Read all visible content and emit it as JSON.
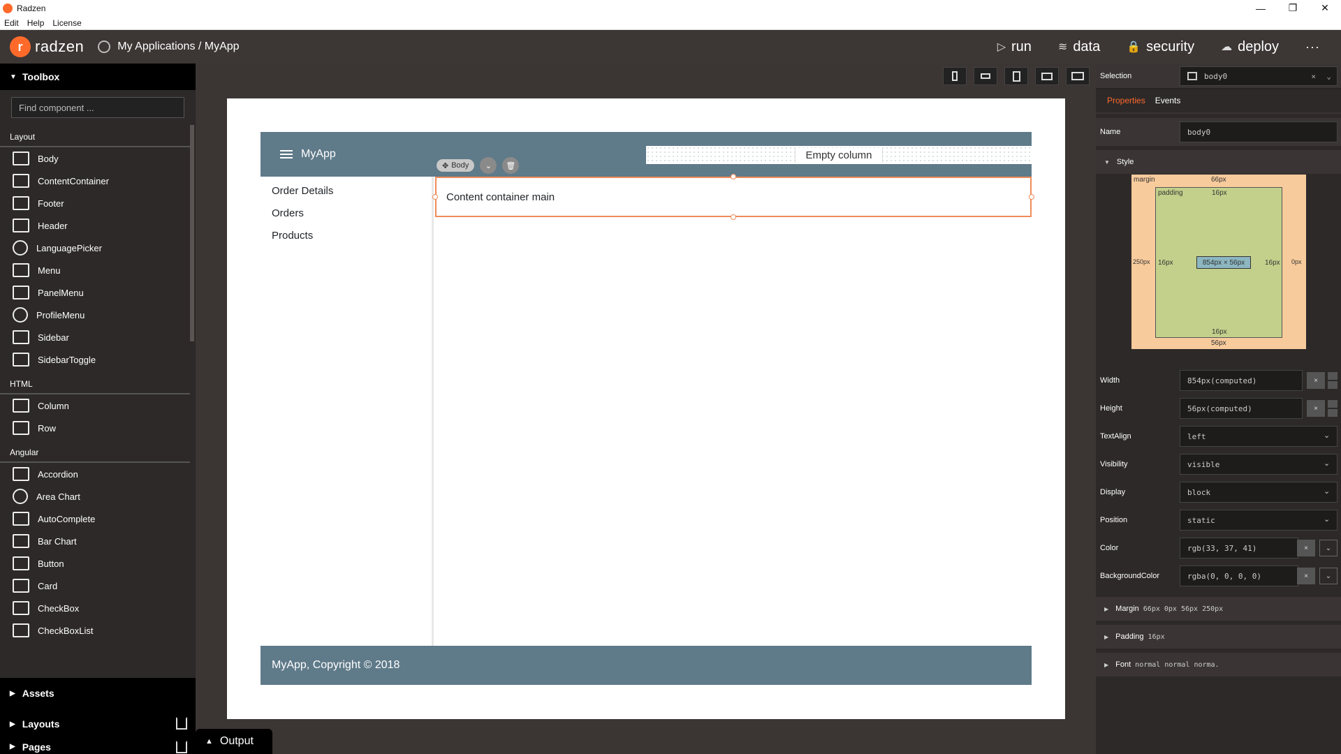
{
  "window": {
    "title": "Radzen",
    "menu": [
      "Edit",
      "Help",
      "License"
    ],
    "controls": [
      "—",
      "❐",
      "✕"
    ]
  },
  "header": {
    "logo_text": "radzen",
    "breadcrumb": "My Applications / MyApp",
    "nav": [
      {
        "label": "run",
        "icon": "play-icon",
        "glyph": "▷"
      },
      {
        "label": "data",
        "icon": "database-icon",
        "glyph": "≋"
      },
      {
        "label": "security",
        "icon": "lock-icon",
        "glyph": "🔒"
      },
      {
        "label": "deploy",
        "icon": "cloud-upload-icon",
        "glyph": "☁"
      }
    ],
    "more": "···"
  },
  "toolbox": {
    "title": "Toolbox",
    "search_placeholder": "Find component ...",
    "categories": [
      {
        "label": "Layout",
        "items": [
          "Body",
          "ContentContainer",
          "Footer",
          "Header",
          "LanguagePicker",
          "Menu",
          "PanelMenu",
          "ProfileMenu",
          "Sidebar",
          "SidebarToggle"
        ]
      },
      {
        "label": "HTML",
        "items": [
          "Column",
          "Row"
        ]
      },
      {
        "label": "Angular",
        "items": [
          "Accordion",
          "Area Chart",
          "AutoComplete",
          "Bar Chart",
          "Button",
          "Card",
          "CheckBox",
          "CheckBoxList"
        ]
      }
    ],
    "bottom": [
      "Assets",
      "Layouts",
      "Pages"
    ]
  },
  "canvas": {
    "app_title": "MyApp",
    "empty_column": "Empty column",
    "body_label": "Body",
    "sidebar_links": [
      "Order Details",
      "Orders",
      "Products"
    ],
    "content_text": "Content container main",
    "footer_text": "MyApp, Copyright © 2018"
  },
  "output_tab": "Output",
  "properties": {
    "selection_label": "Selection",
    "selection_value": "body0",
    "tabs": [
      "Properties",
      "Events"
    ],
    "name_label": "Name",
    "name_value": "body0",
    "style_label": "Style",
    "box": {
      "margin": "margin",
      "padding": "padding",
      "margin_top": "66px",
      "margin_bottom": "56px",
      "margin_left": "250px",
      "margin_right": "0px",
      "padding_top": "16px",
      "padding_bottom": "16px",
      "padding_left": "16px",
      "padding_right": "16px",
      "size": "854px × 56px"
    },
    "fields": [
      {
        "label": "Width",
        "value": "854px(computed)"
      },
      {
        "label": "Height",
        "value": "56px(computed)"
      },
      {
        "label": "TextAlign",
        "value": "left"
      },
      {
        "label": "Visibility",
        "value": "visible"
      },
      {
        "label": "Display",
        "value": "block"
      },
      {
        "label": "Position",
        "value": "static"
      },
      {
        "label": "Color",
        "value": "rgb(33, 37, 41)"
      },
      {
        "label": "BackgroundColor",
        "value": "rgba(0, 0, 0, 0)"
      }
    ],
    "sections": [
      {
        "label": "Margin",
        "value": "66px 0px 56px 250px"
      },
      {
        "label": "Padding",
        "value": "16px"
      },
      {
        "label": "Font",
        "value": "normal normal norma."
      }
    ]
  },
  "colors": {
    "accent": "#ff6a2b",
    "app_header": "#5f7a89",
    "selection_border": "#f08b5a"
  }
}
